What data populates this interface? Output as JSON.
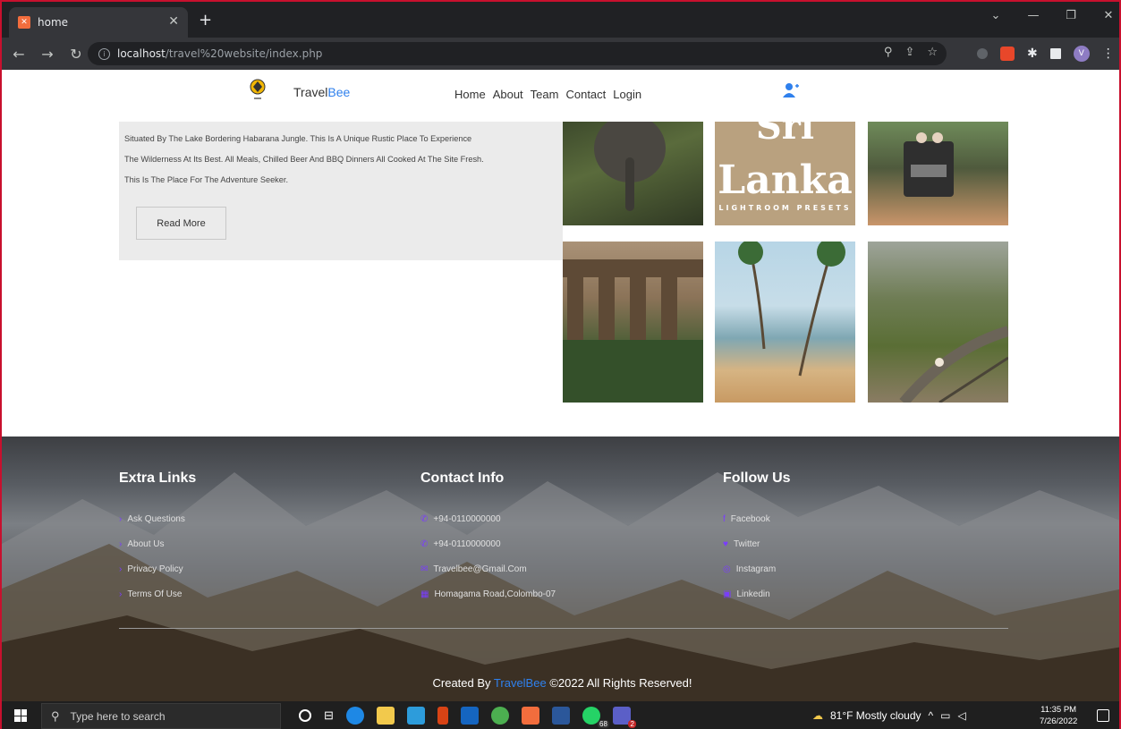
{
  "browser": {
    "tab_title": "home",
    "new_tab_symbol": "+",
    "url_host": "localhost",
    "url_path": "/travel%20website/index.php",
    "profile_initial": "V"
  },
  "site": {
    "brand_prefix": "Travel",
    "brand_accent": "Bee",
    "brand_accent_color": "#2f80ed",
    "nav": [
      "Home",
      "About",
      "Team",
      "Contact",
      "Login"
    ]
  },
  "about": {
    "lines": [
      "Situated By The Lake Bordering Habarana Jungle. This Is A Unique Rustic Place To Experience",
      "The Wilderness At Its Best. All Meals, Chilled Beer And BBQ Dinners All Cooked At The Site Fresh.",
      "This Is The Place For The Adventure Seeker."
    ],
    "read_more": "Read More"
  },
  "gallery": {
    "preset_line1": "Sri",
    "preset_line2": "Lanka",
    "preset_line3": "LIGHTROOM PRESETS"
  },
  "footer": {
    "extra_links": {
      "heading": "Extra Links",
      "items": [
        "Ask Questions",
        "About Us",
        "Privacy Policy",
        "Terms Of Use"
      ]
    },
    "contact_info": {
      "heading": "Contact Info",
      "items": [
        "+94-0110000000",
        "+94-0110000000",
        "Travelbee@Gmail.Com",
        "Homagama Road,Colombo-07"
      ]
    },
    "follow_us": {
      "heading": "Follow Us",
      "items": [
        "Facebook",
        "Twitter",
        "Instagram",
        "Linkedin"
      ]
    },
    "credit_prefix": "Created By ",
    "credit_brand": "TravelBee",
    "credit_suffix": " ©2022 All Rights Reserved!"
  },
  "taskbar": {
    "search_placeholder": "Type here to search",
    "weather": "81°F  Mostly cloudy",
    "time": "11:35 PM",
    "date": "7/26/2022",
    "whatsapp_badge": "68",
    "teams_badge": "2"
  }
}
